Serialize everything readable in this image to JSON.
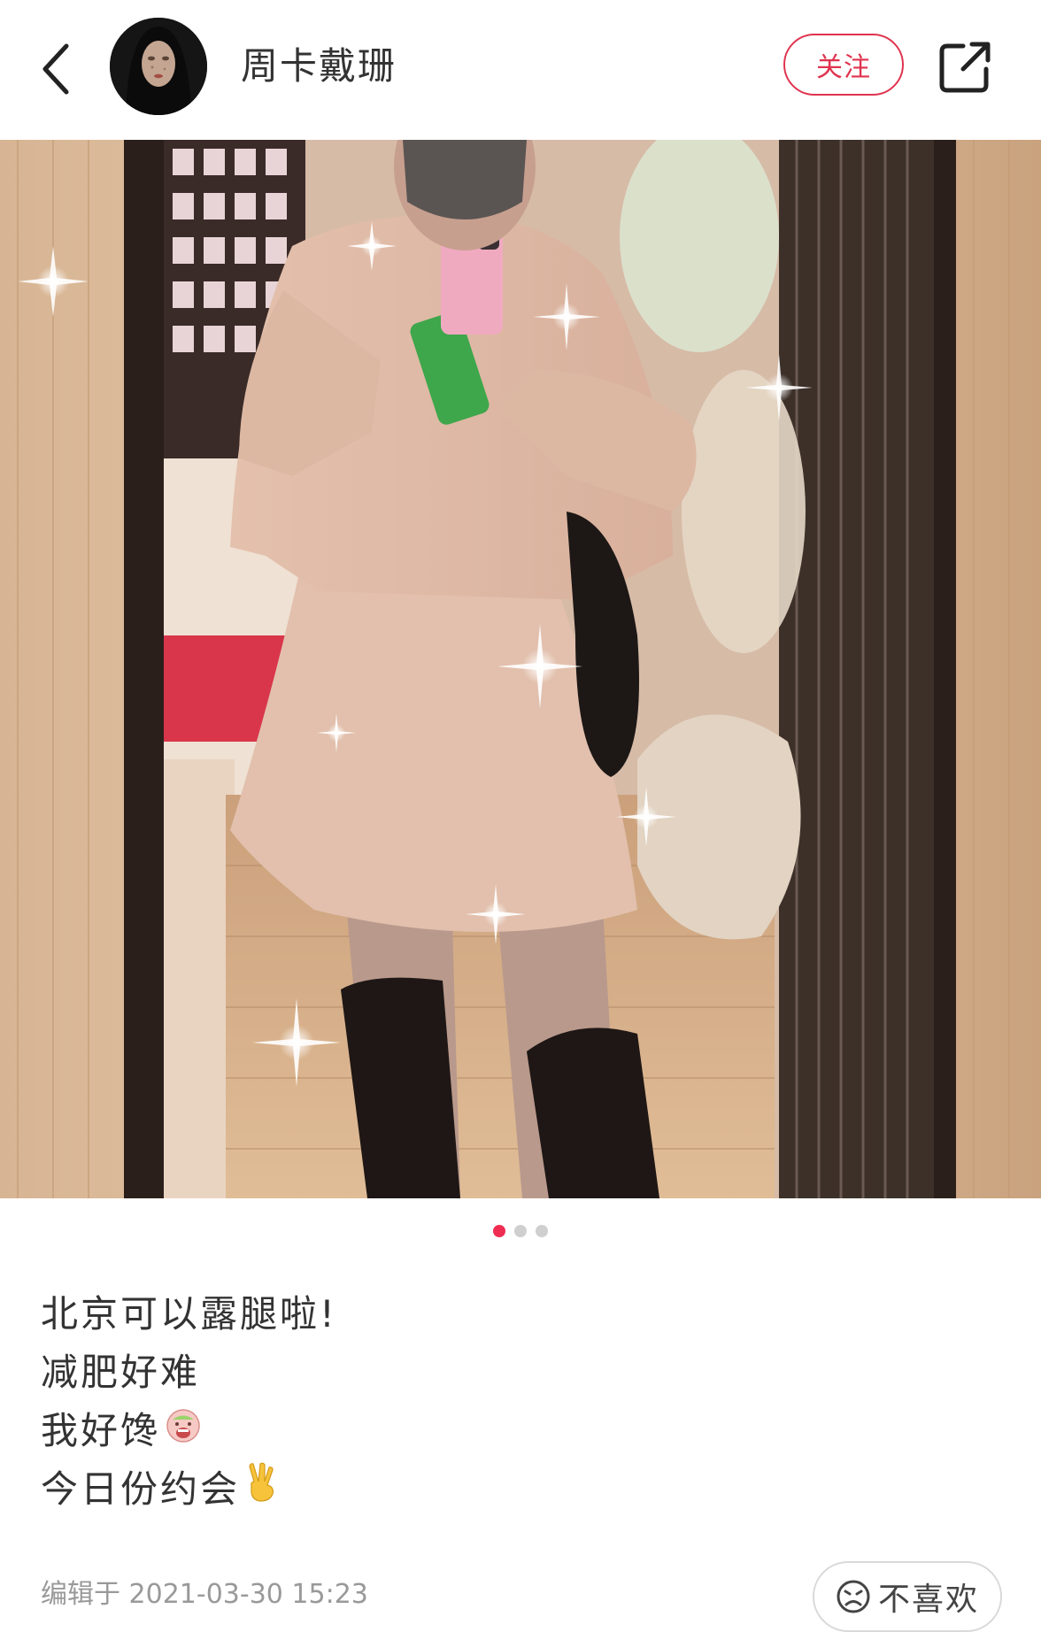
{
  "header": {
    "back_icon": "chevron-left-icon",
    "author_name": "周卡戴珊",
    "follow_label": "关注",
    "share_icon": "share-external-icon"
  },
  "carousel": {
    "total": 3,
    "active_index": 0
  },
  "post": {
    "lines": [
      {
        "text": "北京可以露腿啦!",
        "emoji": ""
      },
      {
        "text": "减肥好难",
        "emoji": ""
      },
      {
        "text": "我好馋",
        "emoji": "drooling-face-emoji"
      },
      {
        "text": "今日份约会",
        "emoji": "victory-hand-emoji"
      }
    ],
    "edit_time": "编辑于 2021-03-30 15:23",
    "dislike_label": "不喜欢",
    "dislike_icon": "frown-face-icon"
  },
  "colors": {
    "accent": "#e0334f",
    "dot_active": "#ef2d52",
    "dot_inactive": "#cfcfcf"
  }
}
